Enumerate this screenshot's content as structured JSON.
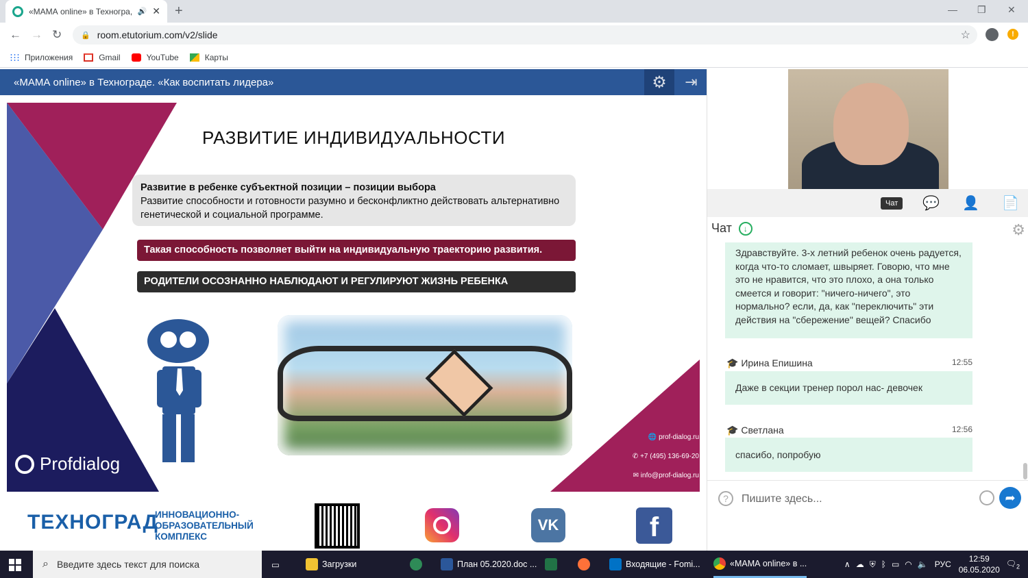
{
  "browser": {
    "tab_title": "«МАМА online» в Техногра,",
    "url": "room.etutorium.com/v2/slide",
    "bookmarks": [
      "Приложения",
      "Gmail",
      "YouTube",
      "Карты"
    ]
  },
  "header": {
    "title": "«МАМА online» в Технограде. «Как воспитать лидера»"
  },
  "slide": {
    "title": "РАЗВИТИЕ ИНДИВИДУАЛЬНОСТИ",
    "box_bold": "Развитие в ребенке субъектной позиции – позиции выбора",
    "box_text": "Развитие способности и готовности разумно и бесконфликтно действовать альтернативно генетической и социальной программе.",
    "red_bar": "Такая способность позволяет выйти на индивидуальную траекторию развития.",
    "dark_bar": "РОДИТЕЛИ  ОСОЗНАННО НАБЛЮДАЮТ И РЕГУЛИРУЮТ ЖИЗНЬ РЕБЕНКА",
    "contacts": [
      "prof-dialog.ru",
      "+7 (495) 136-69-20",
      "info@prof-dialog.ru"
    ],
    "brand": "Profdialog"
  },
  "footer": {
    "technograd": "ТЕХНОГРАД",
    "technograd_sub": [
      "ИННОВАЦИОННО-",
      "ОБРАЗОВАТЕЛЬНЫЙ",
      "КОМПЛЕКС"
    ]
  },
  "panel": {
    "tooltip": "Чат",
    "chat_title": "Чат",
    "messages": [
      {
        "author": "",
        "time": "",
        "text": "Здравствуйте. 3-х летний ребенок очень радуется, когда что-то сломает, швыряет. Говорю, что мне это не нравится, что это плохо, а она только смеется и говорит: \"ничего-ничего\", это нормально? если, да, как \"переключить\" эти действия на \"сбережение\" вещей? Спасибо"
      },
      {
        "author": "Ирина Епишина",
        "time": "12:55",
        "text": "Даже в секции тренер порол нас- девочек"
      },
      {
        "author": "Светлана",
        "time": "12:56",
        "text": "спасибо, попробую"
      }
    ],
    "input_placeholder": "Пишите здесь..."
  },
  "taskbar": {
    "search_placeholder": "Введите здесь текст для поиска",
    "items": [
      "Загрузки",
      "План 05.2020.doc ...",
      "Входящие - Fomi...",
      "«МАМА online» в ..."
    ],
    "lang": "РУС",
    "time": "12:59",
    "date": "06.05.2020",
    "notif_count": "2"
  },
  "colors": {
    "header_blue": "#2b5797",
    "slide_magenta": "#a0205a",
    "slide_navy": "#1c1c5e",
    "chat_bubble": "#dff5eb"
  }
}
